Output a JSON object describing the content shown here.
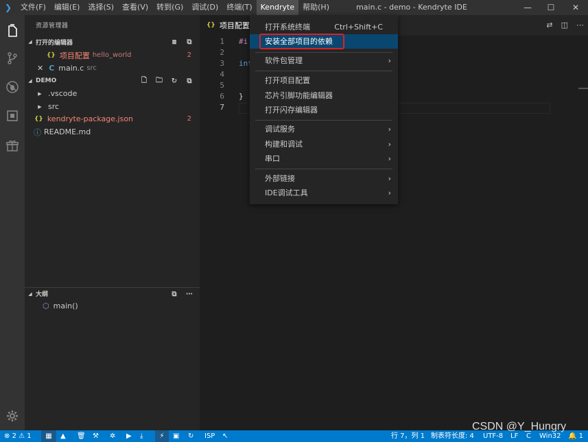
{
  "titlebar": {
    "menus": [
      "文件(F)",
      "编辑(E)",
      "选择(S)",
      "查看(V)",
      "转到(G)",
      "调试(D)",
      "终端(T)",
      "Kendryte",
      "帮助(H)"
    ],
    "window_title": "main.c - demo - Kendryte IDE",
    "minimize": "—",
    "maximize": "☐",
    "close": "✕"
  },
  "sidebar": {
    "title": "资源管理器",
    "open_editors_header": "打开的编辑器",
    "open_editors": [
      {
        "name": "项目配置",
        "desc": "hello_world",
        "badge": "2"
      },
      {
        "name": "main.c",
        "desc": "src"
      }
    ],
    "folder_header": "DEMO",
    "files": [
      {
        "name": ".vscode"
      },
      {
        "name": "src"
      },
      {
        "name": "kendryte-package.json",
        "badge": "2"
      },
      {
        "name": "README.md"
      }
    ],
    "outline_header": "大纲",
    "outline_items": [
      {
        "name": "main()"
      }
    ]
  },
  "editor": {
    "tab_label": "项目配置",
    "line_numbers": [
      "1",
      "2",
      "3",
      "4",
      "5",
      "6",
      "7"
    ],
    "code": {
      "line1": "#i",
      "line3": "int",
      "line6": "}"
    }
  },
  "dropdown": {
    "items": [
      {
        "label": "打开系统终端",
        "shortcut": "Ctrl+Shift+C"
      },
      {
        "label": "安装全部项目的依赖"
      },
      {
        "label": "软件包管理",
        "submenu": "›"
      },
      {
        "label": "打开项目配置"
      },
      {
        "label": "芯片引脚功能编辑器"
      },
      {
        "label": "打开闪存编辑器"
      },
      {
        "label": "调试服务",
        "submenu": "›"
      },
      {
        "label": "构建和调试",
        "submenu": "›"
      },
      {
        "label": "串口",
        "submenu": "›"
      },
      {
        "label": "外部链接",
        "submenu": "›"
      },
      {
        "label": "IDE调试工具",
        "submenu": "›"
      }
    ]
  },
  "statusbar": {
    "errors": "2",
    "warnings": "1",
    "isp": "ISP",
    "position": "行 7，列 1",
    "tab_size": "制表符长度: 4",
    "encoding": "UTF-8",
    "eol": "LF",
    "language": "C",
    "platform": "Win32",
    "notifications": "1"
  },
  "watermark": "CSDN @Y_Hungry"
}
